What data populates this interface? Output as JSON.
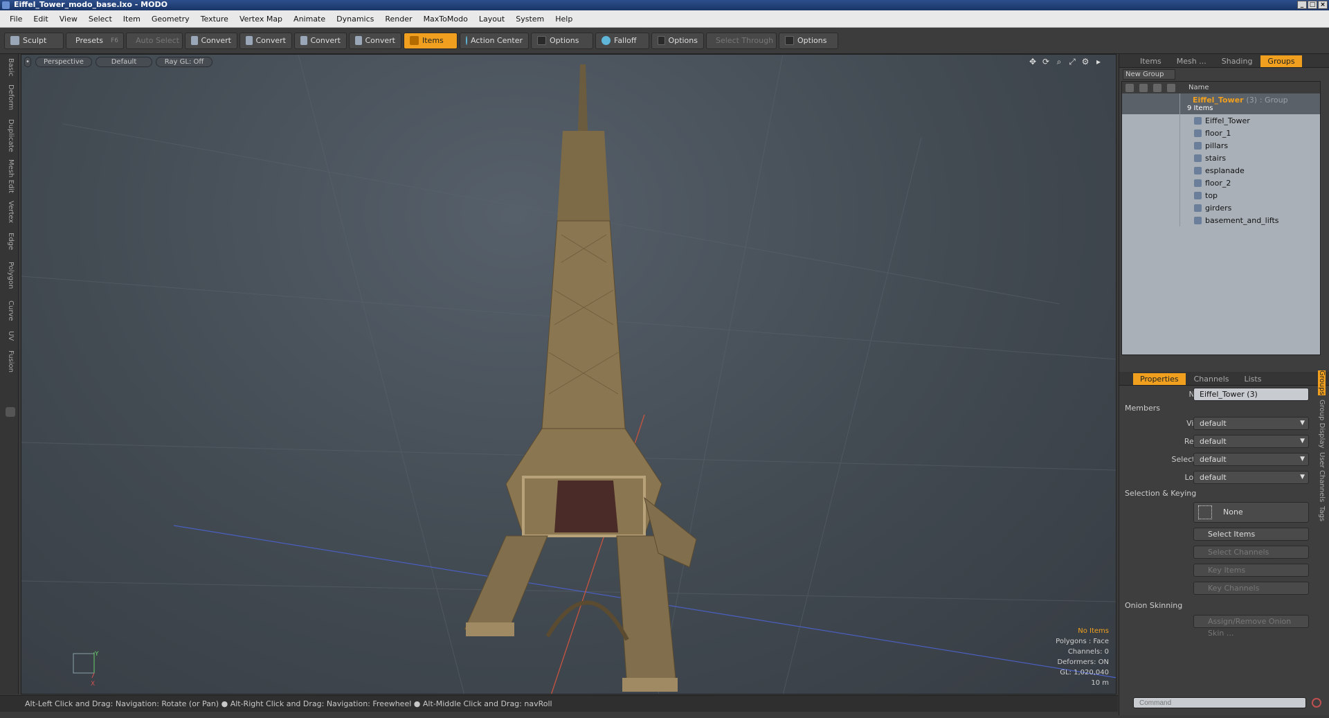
{
  "window": {
    "title": "Eiffel_Tower_modo_base.lxo - MODO"
  },
  "menu": [
    "File",
    "Edit",
    "View",
    "Select",
    "Item",
    "Geometry",
    "Texture",
    "Vertex Map",
    "Animate",
    "Dynamics",
    "Render",
    "MaxToModo",
    "Layout",
    "System",
    "Help"
  ],
  "toolbar": {
    "sculpt": "Sculpt",
    "presets": "Presets",
    "presets_key": "F6",
    "auto_select": "Auto Select",
    "convert": "Convert",
    "items": "Items",
    "action_center": "Action Center",
    "options": "Options",
    "falloff": "Falloff",
    "select_through": "Select Through"
  },
  "lefttabs": [
    "Basic",
    "Deform",
    "Duplicate",
    "Mesh Edit",
    "Vertex",
    "Edge",
    "Polygon",
    "Curve",
    "UV",
    "Fusion"
  ],
  "viewport": {
    "view": "Perspective",
    "shading": "Default",
    "raygl": "Ray GL: Off",
    "stats": {
      "selection": "No Items",
      "polygons": "Polygons : Face",
      "channels": "Channels: 0",
      "deformers": "Deformers: ON",
      "gl": "GL: 1,020,040",
      "scale": "10 m"
    },
    "axis_y": "Y",
    "axis_x": "X"
  },
  "statusbar": "Alt-Left Click and Drag: Navigation: Rotate (or Pan) ● Alt-Right Click and Drag: Navigation: Freewheel ● Alt-Middle Click and Drag: navRoll",
  "top_panel": {
    "tabs": [
      "Items",
      "Mesh ...",
      "Shading",
      "Groups"
    ],
    "new_group": "New Group",
    "name_header": "Name",
    "group": {
      "name": "Eiffel_Tower",
      "count": "(3)",
      "type": ": Group",
      "items": "9 Items"
    },
    "children": [
      "Eiffel_Tower",
      "floor_1",
      "pillars",
      "stairs",
      "esplanade",
      "floor_2",
      "top",
      "girders",
      "basement_and_lifts"
    ]
  },
  "props_panel": {
    "tabs": [
      "Properties",
      "Channels",
      "Lists"
    ],
    "name_label": "Name",
    "name_value": "Eiffel_Tower (3)",
    "members": "Members",
    "visible_label": "Visible",
    "render_label": "Render",
    "selectable_label": "Selectable",
    "locked_label": "Locked",
    "default": "default",
    "sel_keying": "Selection & Keying",
    "none": "None",
    "select_items": "Select Items",
    "select_channels": "Select Channels",
    "key_items": "Key Items",
    "key_channels": "Key Channels",
    "onion": "Onion Skinning",
    "assign_onion": "Assign/Remove Onion Skin ...",
    "side_tabs": [
      "Groups",
      "Group Display",
      "User Channels",
      "Tags"
    ]
  },
  "command": {
    "placeholder": "Command"
  },
  "colors": {
    "accent": "#f0a01e",
    "viewport_bg": "#434b53",
    "panel_bg": "#3e3e3e"
  }
}
